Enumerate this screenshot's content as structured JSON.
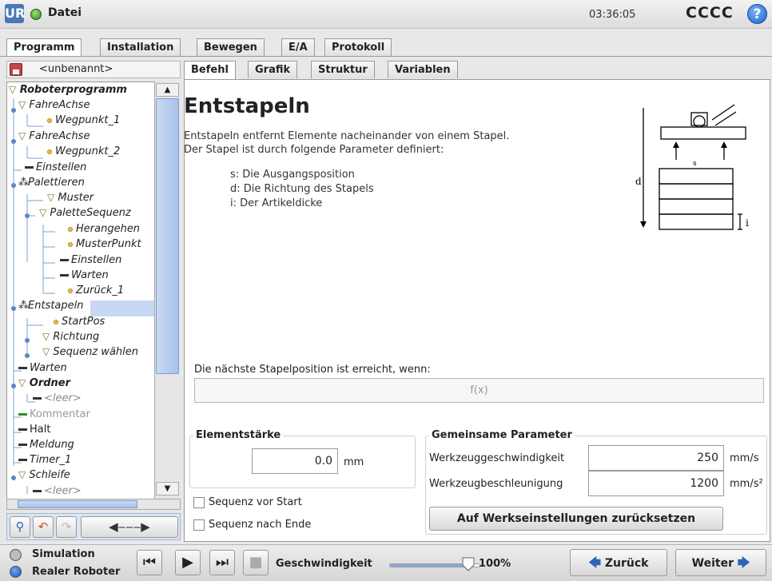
{
  "header": {
    "logo": "UR",
    "file_menu": "Datei",
    "clock": "03:36:05",
    "robot_name": "CCCC",
    "help": "?"
  },
  "tabs": [
    "Programm",
    "Installation",
    "Bewegen",
    "E/A",
    "Protokoll"
  ],
  "subtabs": [
    "Befehl",
    "Grafik",
    "Struktur",
    "Variablen"
  ],
  "program_name": "<unbenannt>",
  "tree": [
    {
      "label": "Roboterprogramm",
      "kind": "root"
    },
    {
      "label": "FahreAchse",
      "kind": "move"
    },
    {
      "label": "Wegpunkt_1",
      "kind": "waypoint"
    },
    {
      "label": "FahreAchse",
      "kind": "move"
    },
    {
      "label": "Wegpunkt_2",
      "kind": "waypoint"
    },
    {
      "label": "Einstellen",
      "kind": "set"
    },
    {
      "label": "Palettieren",
      "kind": "pallet"
    },
    {
      "label": "Muster",
      "kind": "move"
    },
    {
      "label": "PaletteSequenz",
      "kind": "move"
    },
    {
      "label": "Herangehen",
      "kind": "waypoint"
    },
    {
      "label": "MusterPunkt",
      "kind": "waypoint"
    },
    {
      "label": "Einstellen",
      "kind": "set"
    },
    {
      "label": "Warten",
      "kind": "set"
    },
    {
      "label": "Zurück_1",
      "kind": "waypoint"
    },
    {
      "label": "Entstapeln",
      "kind": "pallet"
    },
    {
      "label": "StartPos",
      "kind": "waypoint"
    },
    {
      "label": "Richtung",
      "kind": "move"
    },
    {
      "label": "Sequenz wählen",
      "kind": "move"
    },
    {
      "label": "Warten",
      "kind": "set"
    },
    {
      "label": "Ordner",
      "kind": "folder"
    },
    {
      "label": "<leer>",
      "kind": "empty"
    },
    {
      "label": "Kommentar",
      "kind": "comment"
    },
    {
      "label": "Halt",
      "kind": "halt"
    },
    {
      "label": "Meldung",
      "kind": "set"
    },
    {
      "label": "Timer_1",
      "kind": "set"
    },
    {
      "label": "Schleife",
      "kind": "move"
    },
    {
      "label": "<leer>",
      "kind": "empty"
    }
  ],
  "content": {
    "title": "Entstapeln",
    "desc1": "Entstapeln entfernt Elemente nacheinander von einem Stapel.",
    "desc2": "Der Stapel ist durch folgende Parameter definiert:",
    "param_s": "s: Die Ausgangsposition",
    "param_d": "d: Die Richtung des Stapels",
    "param_i": "i: Der Artikeldicke",
    "diagram": {
      "d": "d",
      "s": "s",
      "i": "i"
    },
    "cond_label": "Die nächste Stapelposition ist erreicht, wenn:",
    "cond_value": "f(x)",
    "element_group": "Elementstärke",
    "element_value": "0.0",
    "element_unit": "mm",
    "chk_before": "Sequenz vor Start",
    "chk_after": "Sequenz nach Ende",
    "params_group": "Gemeinsame Parameter",
    "tool_speed_label": "Werkzeuggeschwindigkeit",
    "tool_speed_value": "250",
    "tool_speed_unit": "mm/s",
    "tool_accel_label": "Werkzeugbeschleunigung",
    "tool_accel_value": "1200",
    "tool_accel_unit": "mm/s²",
    "reset_button": "Auf Werkseinstellungen zurücksetzen"
  },
  "bottom": {
    "simulation": "Simulation",
    "real_robot": "Realer Roboter",
    "speed_label": "Geschwindigkeit",
    "speed_value": "100%",
    "speed_fraction": 1.0,
    "back": "Zurück",
    "next": "Weiter"
  },
  "colors": {
    "accent": "#2f63b8",
    "selected": "#c7d9f2"
  }
}
